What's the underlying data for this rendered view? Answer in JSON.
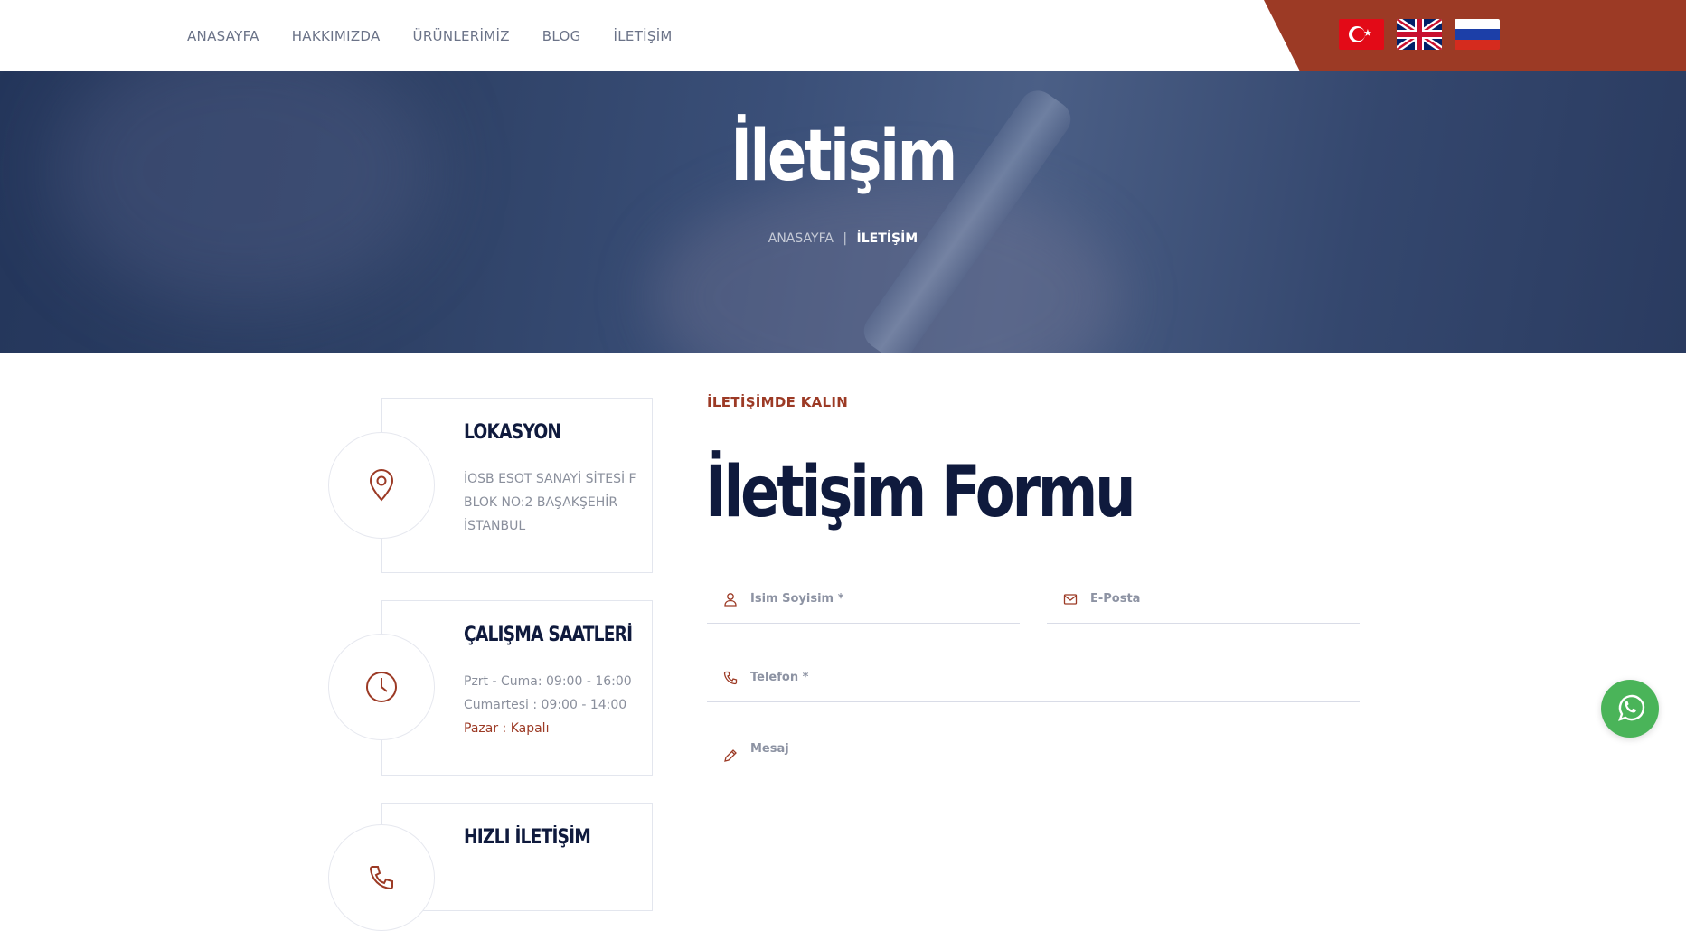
{
  "nav": {
    "items": [
      {
        "label": "ANASAYFA"
      },
      {
        "label": "HAKKIMIZDA"
      },
      {
        "label": "ÜRÜNLERİMİZ"
      },
      {
        "label": "BLOG"
      },
      {
        "label": "İLETİŞİM"
      }
    ]
  },
  "languages": [
    {
      "name": "Türkçe",
      "icon": "turkey-flag-icon"
    },
    {
      "name": "English",
      "icon": "uk-flag-icon"
    },
    {
      "name": "Русский",
      "icon": "russia-flag-icon"
    }
  ],
  "hero": {
    "title": "İletişim",
    "breadcrumb_home": "ANASAYFA",
    "breadcrumb_sep": "|",
    "breadcrumb_current": "İLETİŞİM"
  },
  "cards": {
    "location": {
      "title": "LOKASYON",
      "text": "İOSB ESOT SANAYİ SİTESİ F BLOK NO:2 BAŞAKŞEHİR İSTANBUL",
      "icon": "map-pin-icon"
    },
    "hours": {
      "title": "ÇALIŞMA SAATLERİ",
      "line1": "Pzrt - Cuma: 09:00 - 16:00",
      "line2": "Cumartesi : 09:00 - 14:00",
      "line3": "Pazar : Kapalı",
      "icon": "clock-icon"
    },
    "quick": {
      "title": "HIZLI İLETİŞİM",
      "icon": "phone-icon"
    }
  },
  "form": {
    "eyebrow": "İLETİŞİMDE KALIN",
    "title": "İletişim Formu",
    "name_placeholder": "İsim Soyisim *",
    "email_placeholder": "E-Posta",
    "phone_placeholder": "Telefon *",
    "message_placeholder": "Mesaj"
  },
  "colors": {
    "accent": "#9c3a25",
    "navy": "#0f1a3d",
    "whatsapp": "#4ab459"
  }
}
